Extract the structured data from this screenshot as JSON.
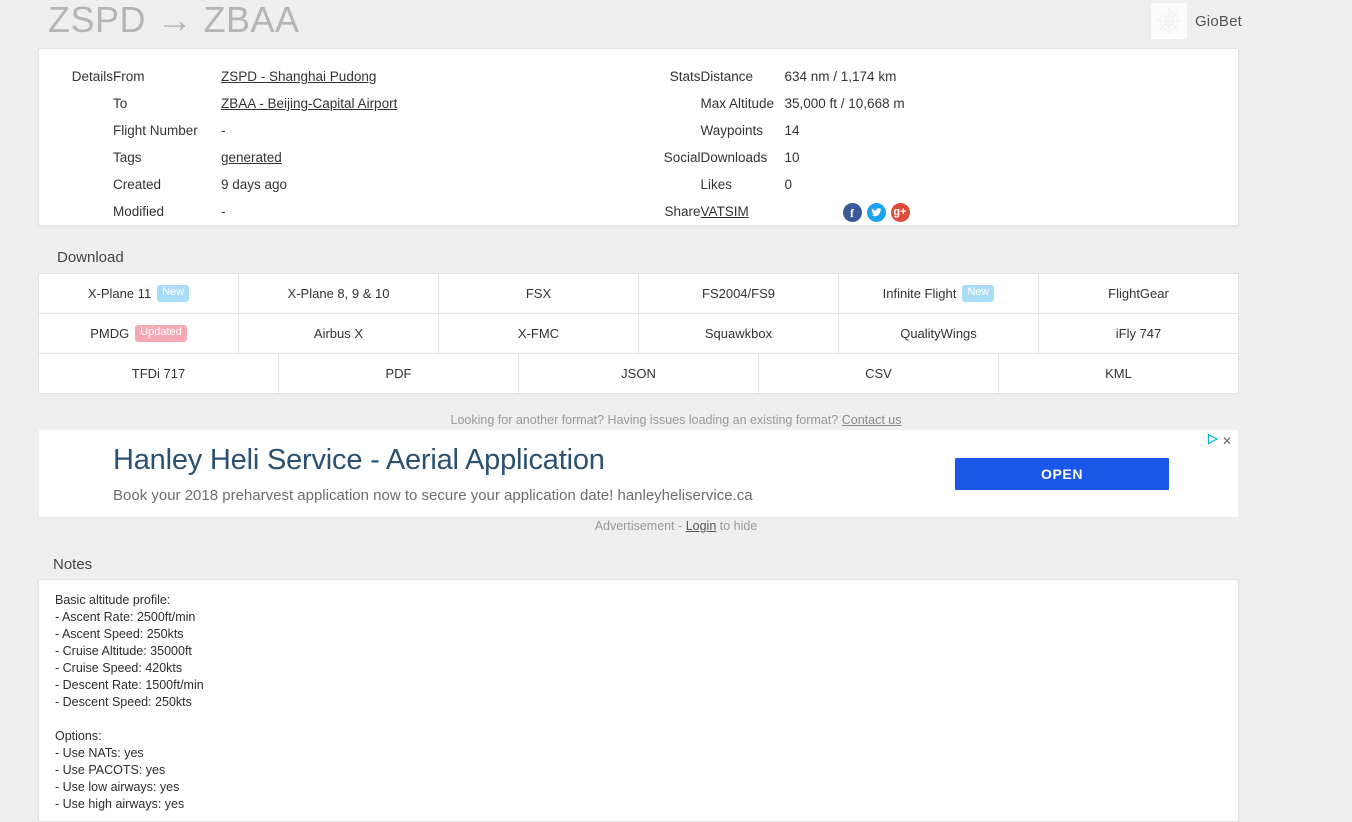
{
  "header": {
    "route_title": "ZSPD → ZBAA",
    "brand_name": "GioBet",
    "brand_logo_icon": "giobet-logo-icon"
  },
  "details": {
    "section_label": "Details",
    "rows": [
      {
        "key": "From",
        "value": "ZSPD - Shanghai Pudong",
        "is_link": true
      },
      {
        "key": "To",
        "value": "ZBAA - Beijing-Capital Airport",
        "is_link": true
      },
      {
        "key": "Flight Number",
        "value": "-",
        "is_link": false
      },
      {
        "key": "Tags",
        "value": "generated",
        "is_link": true
      },
      {
        "key": "Created",
        "value": "9 days ago",
        "is_link": false
      },
      {
        "key": "Modified",
        "value": "-",
        "is_link": false
      }
    ]
  },
  "stats": {
    "section_label": "Stats",
    "rows": [
      {
        "key": "Distance",
        "value": "634 nm / 1,174 km"
      },
      {
        "key": "Max Altitude",
        "value": "35,000 ft / 10,668 m"
      },
      {
        "key": "Waypoints",
        "value": "14"
      }
    ]
  },
  "social": {
    "section_label": "Social",
    "rows": [
      {
        "key": "Downloads",
        "value": "10"
      },
      {
        "key": "Likes",
        "value": "0"
      }
    ]
  },
  "share": {
    "section_label": "Share",
    "vatsim_label": "VATSIM",
    "icons": [
      {
        "name": "facebook-icon",
        "glyph": "f",
        "color": "#3b5998"
      },
      {
        "name": "twitter-icon",
        "glyph": "🐦",
        "color": "#1da1f2"
      },
      {
        "name": "google-plus-icon",
        "glyph": "g+",
        "color": "#dd4b39"
      }
    ]
  },
  "download": {
    "heading": "Download",
    "rows": [
      [
        {
          "label": "X-Plane 11",
          "badge": "New",
          "badge_type": "new"
        },
        {
          "label": "X-Plane 8, 9 & 10",
          "badge": "",
          "badge_type": ""
        },
        {
          "label": "FSX",
          "badge": "",
          "badge_type": ""
        },
        {
          "label": "FS2004/FS9",
          "badge": "",
          "badge_type": ""
        },
        {
          "label": "Infinite Flight",
          "badge": "New",
          "badge_type": "new"
        },
        {
          "label": "FlightGear",
          "badge": "",
          "badge_type": ""
        }
      ],
      [
        {
          "label": "PMDG",
          "badge": "Updated",
          "badge_type": "updated"
        },
        {
          "label": "Airbus X",
          "badge": "",
          "badge_type": ""
        },
        {
          "label": "X-FMC",
          "badge": "",
          "badge_type": ""
        },
        {
          "label": "Squawkbox",
          "badge": "",
          "badge_type": ""
        },
        {
          "label": "QualityWings",
          "badge": "",
          "badge_type": ""
        },
        {
          "label": "iFly 747",
          "badge": "",
          "badge_type": ""
        }
      ],
      [
        {
          "label": "TFDi 717",
          "badge": "",
          "badge_type": ""
        },
        {
          "label": "PDF",
          "badge": "",
          "badge_type": ""
        },
        {
          "label": "JSON",
          "badge": "",
          "badge_type": ""
        },
        {
          "label": "CSV",
          "badge": "",
          "badge_type": ""
        },
        {
          "label": "KML",
          "badge": "",
          "badge_type": ""
        }
      ]
    ],
    "footer_text": "Looking for another format? Having issues loading an existing format? ",
    "footer_link": "Contact us"
  },
  "ad": {
    "title": "Hanley Heli Service - Aerial Application",
    "subtitle": "Book your 2018 preharvest application now to secure your application date! hanleyheliservice.ca",
    "button_label": "OPEN",
    "adchoices_icon": "adchoices-icon",
    "close_icon": "close-icon",
    "disclaimer_prefix": "Advertisement - ",
    "disclaimer_link": "Login",
    "disclaimer_suffix": " to hide"
  },
  "notes": {
    "heading": "Notes",
    "body": "Basic altitude profile:\n- Ascent Rate: 2500ft/min\n- Ascent Speed: 250kts\n- Cruise Altitude: 35000ft\n- Cruise Speed: 420kts\n- Descent Rate: 1500ft/min\n- Descent Speed: 250kts\n\nOptions:\n- Use NATs: yes\n- Use PACOTS: yes\n- Use low airways: yes\n- Use high airways: yes"
  },
  "colors": {
    "page_bg": "#efefef",
    "card_bg": "#ffffff",
    "title_gray": "#b5b5b5",
    "badge_new": "#a9ddf7",
    "badge_updated": "#f7aab4",
    "ad_button": "#1a56e8",
    "ad_title": "#2b5070"
  }
}
